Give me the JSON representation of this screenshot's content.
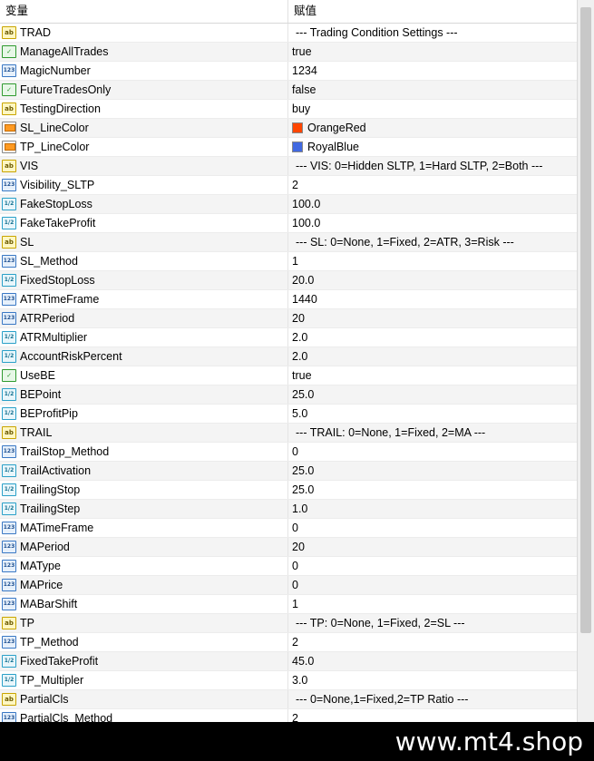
{
  "header": {
    "name_col": "变量",
    "value_col": "赋值"
  },
  "icons": {
    "string": "ab",
    "int": "123",
    "double": "1/2",
    "bool": "✓",
    "color": ""
  },
  "rows": [
    {
      "name": "TRAD",
      "type": "string",
      "value": "--- Trading Condition Settings ---"
    },
    {
      "name": "ManageAllTrades",
      "type": "bool",
      "value": "true"
    },
    {
      "name": "MagicNumber",
      "type": "int",
      "value": "1234"
    },
    {
      "name": "FutureTradesOnly",
      "type": "bool",
      "value": "false"
    },
    {
      "name": "TestingDirection",
      "type": "string",
      "value": "buy"
    },
    {
      "name": "SL_LineColor",
      "type": "color",
      "value": "OrangeRed",
      "swatch": "#ff4500"
    },
    {
      "name": "TP_LineColor",
      "type": "color",
      "value": "RoyalBlue",
      "swatch": "#4169e1"
    },
    {
      "name": "VIS",
      "type": "string",
      "value": "--- VIS: 0=Hidden SLTP, 1=Hard SLTP, 2=Both ---"
    },
    {
      "name": "Visibility_SLTP",
      "type": "int",
      "value": "2"
    },
    {
      "name": "FakeStopLoss",
      "type": "double",
      "value": "100.0"
    },
    {
      "name": "FakeTakeProfit",
      "type": "double",
      "value": "100.0"
    },
    {
      "name": "SL",
      "type": "string",
      "value": "--- SL: 0=None, 1=Fixed, 2=ATR, 3=Risk ---"
    },
    {
      "name": "SL_Method",
      "type": "int",
      "value": "1"
    },
    {
      "name": "FixedStopLoss",
      "type": "double",
      "value": "20.0"
    },
    {
      "name": "ATRTimeFrame",
      "type": "int",
      "value": "1440"
    },
    {
      "name": "ATRPeriod",
      "type": "int",
      "value": "20"
    },
    {
      "name": "ATRMultiplier",
      "type": "double",
      "value": "2.0"
    },
    {
      "name": "AccountRiskPercent",
      "type": "double",
      "value": "2.0"
    },
    {
      "name": "UseBE",
      "type": "bool",
      "value": "true"
    },
    {
      "name": "BEPoint",
      "type": "double",
      "value": "25.0"
    },
    {
      "name": "BEProfitPip",
      "type": "double",
      "value": "5.0"
    },
    {
      "name": "TRAIL",
      "type": "string",
      "value": "--- TRAIL: 0=None, 1=Fixed, 2=MA ---"
    },
    {
      "name": "TrailStop_Method",
      "type": "int",
      "value": "0"
    },
    {
      "name": "TrailActivation",
      "type": "double",
      "value": "25.0"
    },
    {
      "name": "TrailingStop",
      "type": "double",
      "value": "25.0"
    },
    {
      "name": "TrailingStep",
      "type": "double",
      "value": "1.0"
    },
    {
      "name": "MATimeFrame",
      "type": "int",
      "value": "0"
    },
    {
      "name": "MAPeriod",
      "type": "int",
      "value": "20"
    },
    {
      "name": "MAType",
      "type": "int",
      "value": "0"
    },
    {
      "name": "MAPrice",
      "type": "int",
      "value": "0"
    },
    {
      "name": "MABarShift",
      "type": "int",
      "value": "1"
    },
    {
      "name": "TP",
      "type": "string",
      "value": "--- TP: 0=None, 1=Fixed, 2=SL ---"
    },
    {
      "name": "TP_Method",
      "type": "int",
      "value": "2"
    },
    {
      "name": "FixedTakeProfit",
      "type": "double",
      "value": "45.0"
    },
    {
      "name": "TP_Multipler",
      "type": "double",
      "value": "3.0"
    },
    {
      "name": "PartialCls",
      "type": "string",
      "value": "--- 0=None,1=Fixed,2=TP Ratio ---"
    },
    {
      "name": "PartialCls_Method",
      "type": "int",
      "value": "2"
    }
  ],
  "footer": {
    "brand": "www.mt4.shop"
  }
}
